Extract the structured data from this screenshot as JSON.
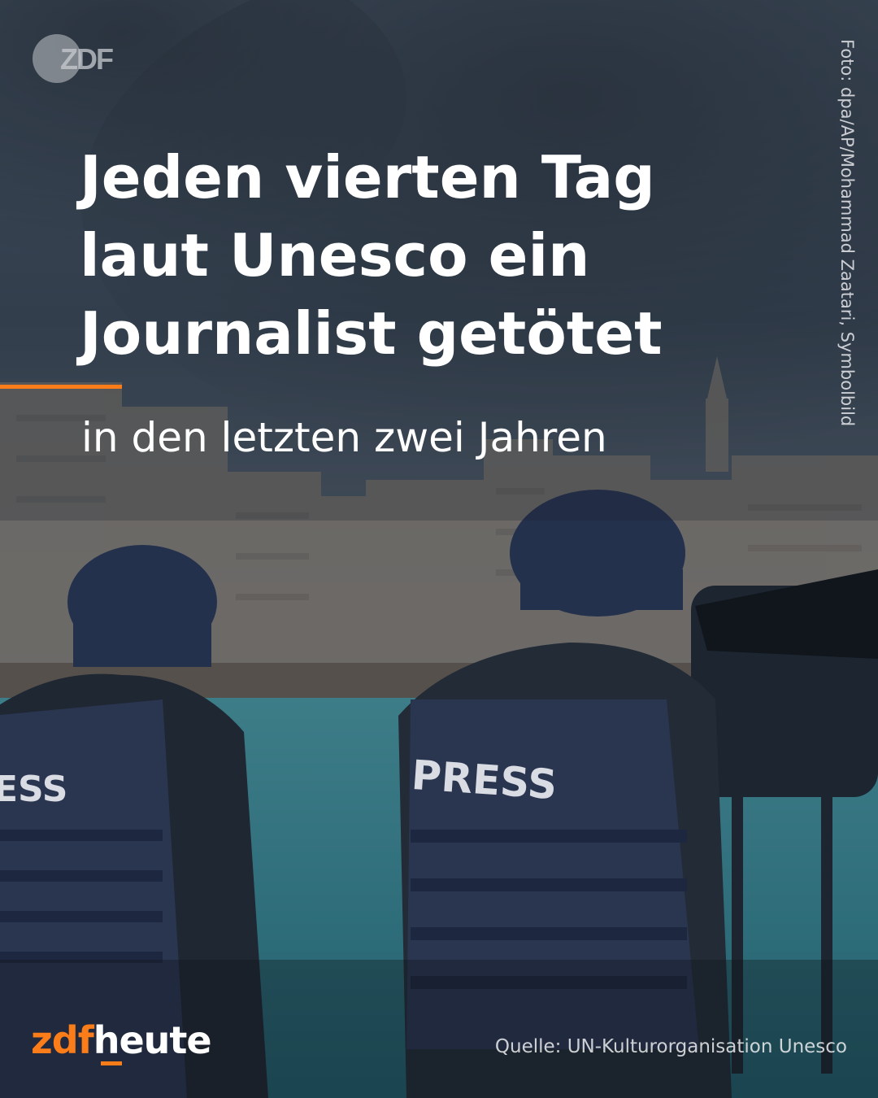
{
  "headline": "Jeden vierten Tag laut Unesco ein Journalist getötet",
  "subline": "in den letzten zwei Jahren",
  "photo_credit": "Foto: dpa/AP/Mohammad Zaatari, Symbolbild",
  "source": "Quelle: UN-Kulturorganisation Unesco",
  "brand": {
    "zdf": "zdf",
    "heute": "heute"
  },
  "logo_text": "ZDF",
  "vest_left_text": "ESS",
  "vest_right_text": "PRESS",
  "colors": {
    "accent": "#fa7d19",
    "sky": "#3b4a5b",
    "sea": "#2f7a8a",
    "vest": "#2a3550"
  }
}
